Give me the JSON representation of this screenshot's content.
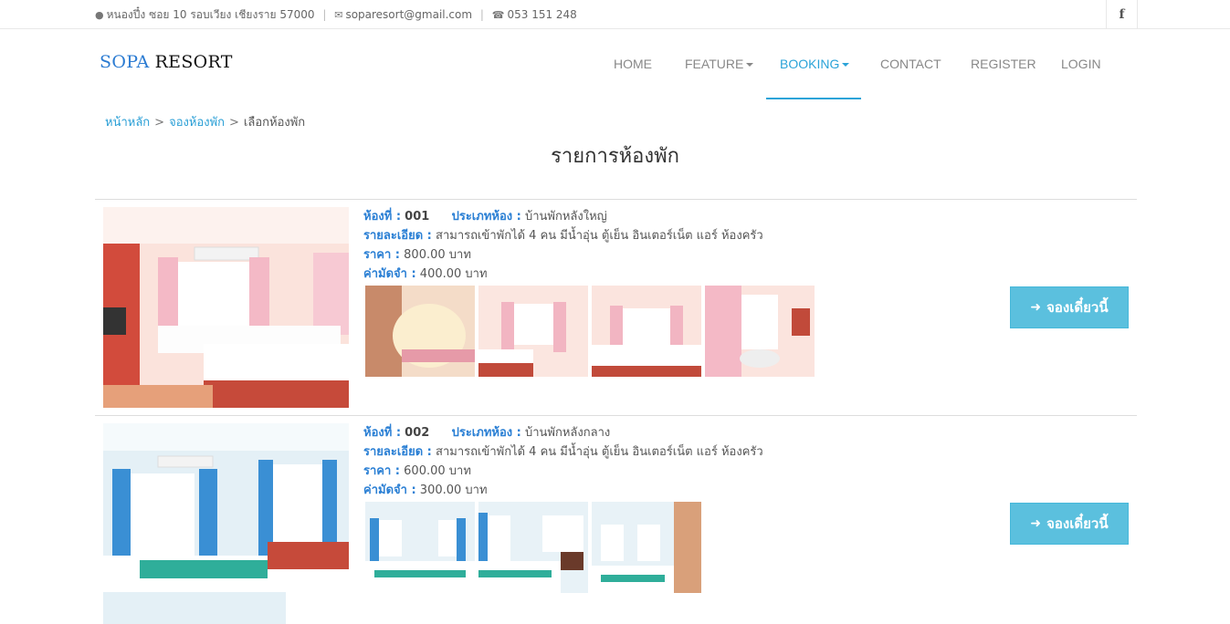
{
  "topbar": {
    "address": "หนองปึ๋ง ซอย 10 รอบเวียง เชียงราย 57000",
    "email": "soparesort@gmail.com",
    "phone": "053 151 248",
    "social_icon": "facebook-icon",
    "social_label": "f"
  },
  "brand": {
    "part1": "SOPA",
    "part2": "RESORT"
  },
  "nav": {
    "items": [
      {
        "label": "HOME"
      },
      {
        "label": "FEATURE"
      },
      {
        "label": "BOOKING"
      },
      {
        "label": "CONTACT"
      },
      {
        "label": "REGISTER"
      },
      {
        "label": "LOGIN"
      }
    ],
    "active": "BOOKING"
  },
  "breadcrumb": {
    "items": [
      "หน้าหลัก",
      "จองห้องพัก",
      "เลือกห้องพัก"
    ],
    "separator": ">"
  },
  "page_title": "รายการห้องพัก",
  "labels": {
    "room_no": "ห้องที่ :",
    "room_type": "ประเภทห้อง :",
    "detail": "รายละเอียด :",
    "price": "ราคา :",
    "deposit": "ค่ามัดจำ :"
  },
  "rooms": [
    {
      "room_no": "001",
      "room_type": "บ้านพักหลังใหญ่",
      "detail": "สามารถเข้าพักได้ 4 คน มีน้ำอุ่น ตู้เย็น อินเตอร์เน็ต แอร์ ห้องครัว",
      "price": "800.00 บาท",
      "deposit": "400.00 บาท",
      "button": "จองเดี๋ยวนี้"
    },
    {
      "room_no": "002",
      "room_type": "บ้านพักหลังกลาง",
      "detail": "สามารถเข้าพักได้ 4 คน มีน้ำอุ่น ตู้เย็น อินเตอร์เน็ต แอร์ ห้องครัว",
      "price": "600.00 บาท",
      "deposit": "300.00 บาท",
      "button": "จองเดี๋ยวนี้"
    }
  ],
  "colors": {
    "accent": "#2aa3d8",
    "label_blue": "#2a7fd4",
    "button": "#5bc0de"
  }
}
